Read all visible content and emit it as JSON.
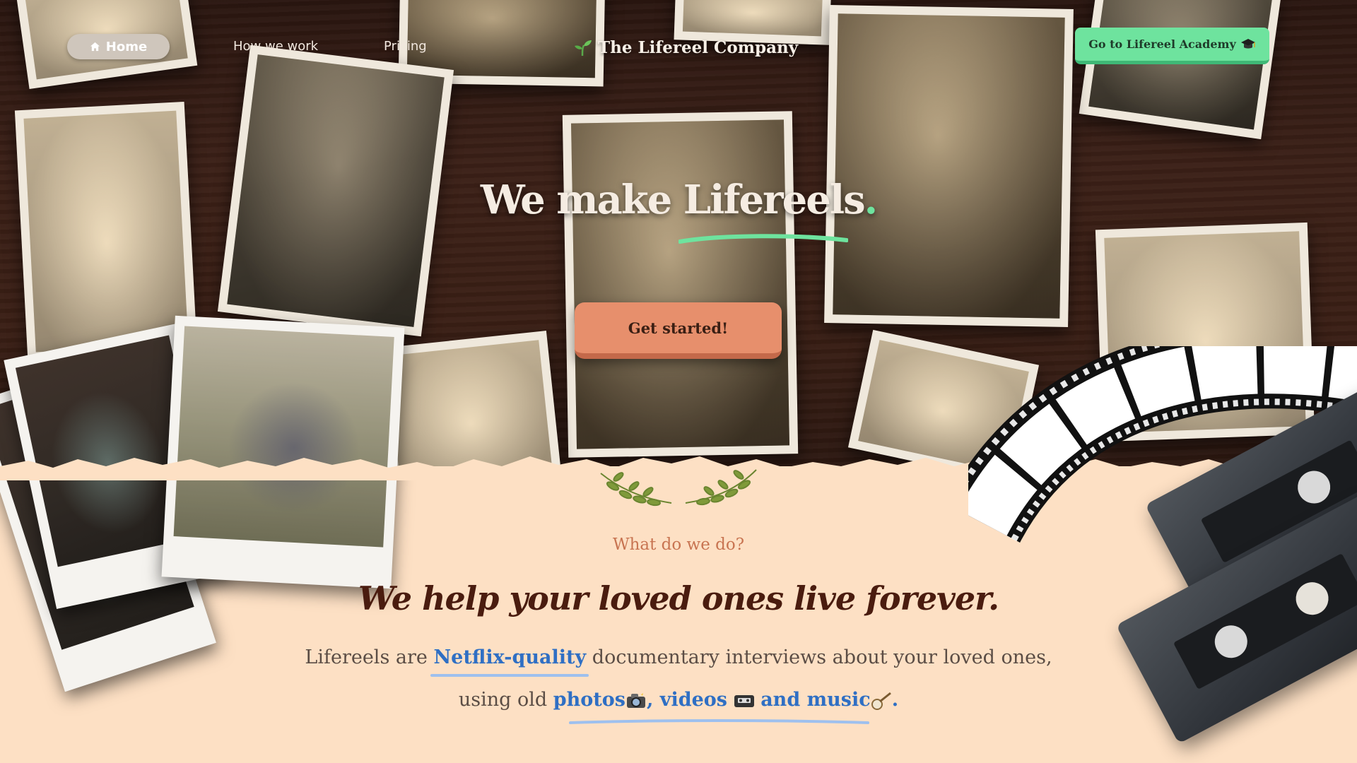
{
  "nav": {
    "home_label": "Home",
    "how_label": "How we work",
    "pricing_label": "Pricing",
    "brand_name": "The Lifereel Company",
    "academy_label": "Go to Lifereel Academy"
  },
  "hero": {
    "headline": "We make Lifereels",
    "headline_dot": ".",
    "cta_label": "Get started!"
  },
  "intro": {
    "eyebrow": "What do we do?",
    "tagline": "We help your loved ones live forever.",
    "line1_prefix": "Lifereels are",
    "line1_highlight": "Netflix-quality",
    "line1_suffix": "documentary interviews about your loved ones,",
    "line2_prefix": "using old",
    "line2_photos": "photos",
    "line2_videos": ", videos",
    "line2_music": "and music",
    "line2_end": "."
  },
  "icons": {
    "home": "home-icon",
    "sprout": "sprout-icon",
    "graduation": "graduation-cap-icon",
    "camera": "camera-icon",
    "cassette": "cassette-icon",
    "banjo": "banjo-icon"
  },
  "colors": {
    "accent_green": "#6ee39e",
    "cta_orange": "#e78f6c",
    "link_blue": "#2f6fc4",
    "tagline_brown": "#4a1c0f",
    "section_bg": "#fde0c4"
  }
}
